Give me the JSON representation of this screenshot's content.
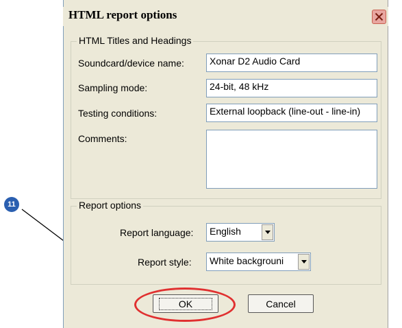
{
  "dialog": {
    "title": "HTML report options",
    "close_icon": "close-icon"
  },
  "titles_group": {
    "legend": "HTML Titles and Headings",
    "fields": [
      {
        "label": "Soundcard/device name:",
        "value": "Xonar D2 Audio Card"
      },
      {
        "label": "Sampling mode:",
        "value": "24-bit, 48 kHz"
      },
      {
        "label": "Testing conditions:",
        "value": "External loopback (line-out - line-in)"
      },
      {
        "label": "Comments:",
        "value": ""
      }
    ]
  },
  "report_group": {
    "legend": "Report options",
    "language_label": "Report language:",
    "language_value": "English",
    "style_label": "Report style:",
    "style_value": "White backgrouni"
  },
  "buttons": {
    "ok_label": "OK",
    "cancel_label": "Cancel"
  },
  "annotation": {
    "step_number": "11",
    "highlight_color": "#e03030",
    "badge_color": "#2a5fb0"
  }
}
